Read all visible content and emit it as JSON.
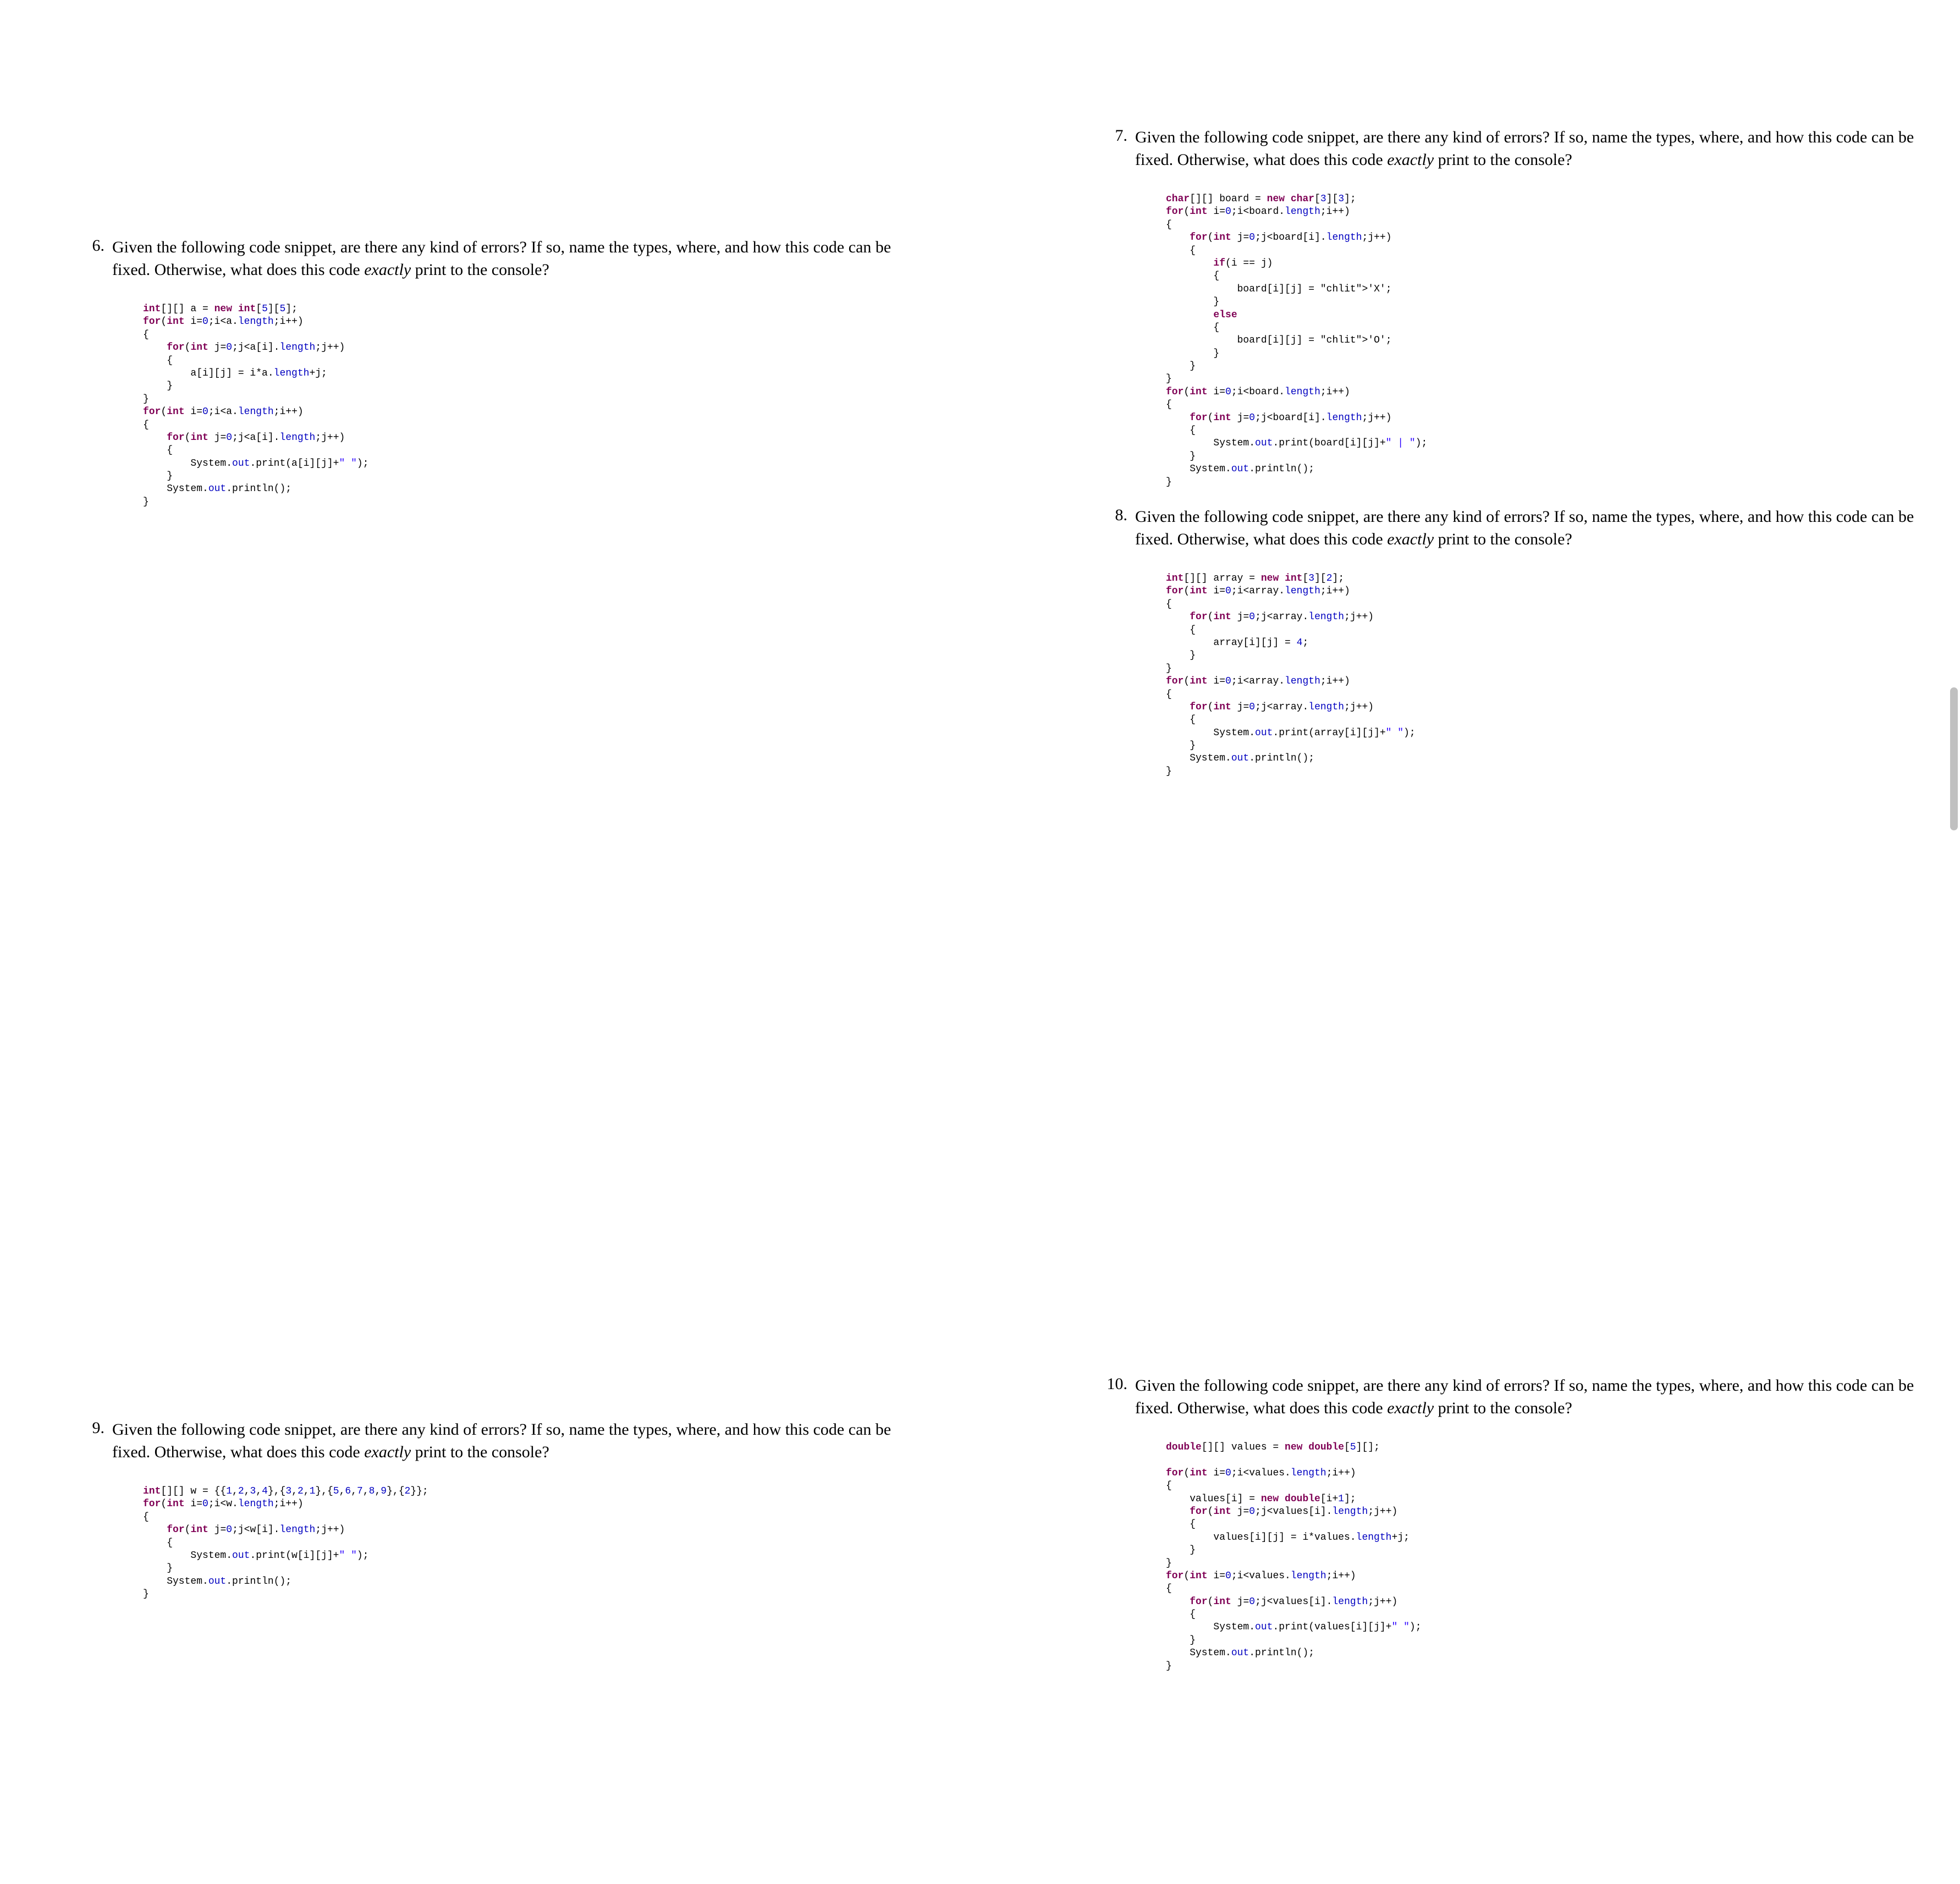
{
  "questions": {
    "q6": {
      "number": "6.",
      "prompt_pre": "Given the following code snippet, are there any kind of errors? If so, name the types, where, and how this code can be fixed. Otherwise, what does this code ",
      "prompt_em": "exactly",
      "prompt_post": " print to the console?",
      "code": "int[][] a = new int[5][5];\nfor(int i=0;i<a.length;i++)\n{\n    for(int j=0;j<a[i].length;j++)\n    {\n        a[i][j] = i*a.length+j;\n    }\n}\nfor(int i=0;i<a.length;i++)\n{\n    for(int j=0;j<a[i].length;j++)\n    {\n        System.out.print(a[i][j]+\" \");\n    }\n    System.out.println();\n}"
    },
    "q7": {
      "number": "7.",
      "prompt_pre": "Given the following code snippet, are there any kind of errors? If so, name the types, where, and how this code can be fixed. Otherwise, what does this code ",
      "prompt_em": "exactly",
      "prompt_post": " print to the console?",
      "code": "char[][] board = new char[3][3];\nfor(int i=0;i<board.length;i++)\n{\n    for(int j=0;j<board[i].length;j++)\n    {\n        if(i == j)\n        {\n            board[i][j] = 'X';\n        }\n        else\n        {\n            board[i][j] = 'O';\n        }\n    }\n}\nfor(int i=0;i<board.length;i++)\n{\n    for(int j=0;j<board[i].length;j++)\n    {\n        System.out.print(board[i][j]+\" | \");\n    }\n    System.out.println();\n}"
    },
    "q8": {
      "number": "8.",
      "prompt_pre": "Given the following code snippet, are there any kind of errors? If so, name the types, where, and how this code can be fixed. Otherwise, what does this code ",
      "prompt_em": "exactly",
      "prompt_post": " print to the console?",
      "code": "int[][] array = new int[3][2];\nfor(int i=0;i<array.length;i++)\n{\n    for(int j=0;j<array.length;j++)\n    {\n        array[i][j] = 4;\n    }\n}\nfor(int i=0;i<array.length;i++)\n{\n    for(int j=0;j<array.length;j++)\n    {\n        System.out.print(array[i][j]+\" \");\n    }\n    System.out.println();\n}"
    },
    "q9": {
      "number": "9.",
      "prompt_pre": "Given the following code snippet, are there any kind of errors? If so, name the types, where, and how this code can be fixed. Otherwise, what does this code ",
      "prompt_em": "exactly",
      "prompt_post": " print to the console?",
      "code": "int[][] w = {{1,2,3,4},{3,2,1},{5,6,7,8,9},{2}};\nfor(int i=0;i<w.length;i++)\n{\n    for(int j=0;j<w[i].length;j++)\n    {\n        System.out.print(w[i][j]+\" \");\n    }\n    System.out.println();\n}"
    },
    "q10": {
      "number": "10.",
      "prompt_pre": "Given the following code snippet, are there any kind of errors? If so, name the types, where, and how this code can be fixed. Otherwise, what does this code ",
      "prompt_em": "exactly",
      "prompt_post": " print to the console?",
      "code": "double[][] values = new double[5][];\n\nfor(int i=0;i<values.length;i++)\n{\n    values[i] = new double[i+1];\n    for(int j=0;j<values[i].length;j++)\n    {\n        values[i][j] = i*values.length+j;\n    }\n}\nfor(int i=0;i<values.length;i++)\n{\n    for(int j=0;j<values[i].length;j++)\n    {\n        System.out.print(values[i][j]+\" \");\n    }\n    System.out.println();\n}"
    }
  }
}
